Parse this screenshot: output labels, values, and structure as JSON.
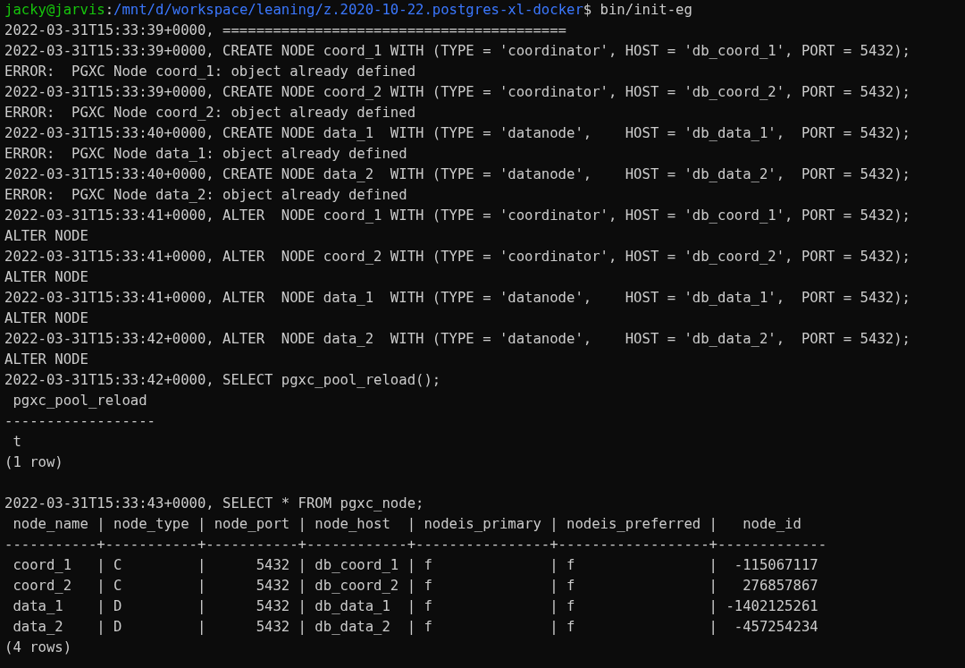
{
  "prompt": {
    "user_host": "jacky@jarvis",
    "separator": ":",
    "path": "/mnt/d/workspace/leaning/z.2020-10-22.postgres-xl-docker",
    "command": "$ bin/init-eg"
  },
  "blocks": [
    [
      "2022-03-31T15:33:39+0000, =========================================",
      "2022-03-31T15:33:39+0000, CREATE NODE coord_1 WITH (TYPE = 'coordinator', HOST = 'db_coord_1', PORT = 5432);",
      "ERROR:  PGXC Node coord_1: object already defined",
      "2022-03-31T15:33:39+0000, CREATE NODE coord_2 WITH (TYPE = 'coordinator', HOST = 'db_coord_2', PORT = 5432);",
      "ERROR:  PGXC Node coord_2: object already defined",
      "2022-03-31T15:33:40+0000, CREATE NODE data_1  WITH (TYPE = 'datanode',    HOST = 'db_data_1',  PORT = 5432);",
      "ERROR:  PGXC Node data_1: object already defined",
      "2022-03-31T15:33:40+0000, CREATE NODE data_2  WITH (TYPE = 'datanode',    HOST = 'db_data_2',  PORT = 5432);",
      "ERROR:  PGXC Node data_2: object already defined",
      "2022-03-31T15:33:41+0000, ALTER  NODE coord_1 WITH (TYPE = 'coordinator', HOST = 'db_coord_1', PORT = 5432);",
      "ALTER NODE",
      "2022-03-31T15:33:41+0000, ALTER  NODE coord_2 WITH (TYPE = 'coordinator', HOST = 'db_coord_2', PORT = 5432);",
      "ALTER NODE",
      "2022-03-31T15:33:41+0000, ALTER  NODE data_1  WITH (TYPE = 'datanode',    HOST = 'db_data_1',  PORT = 5432);",
      "ALTER NODE",
      "2022-03-31T15:33:42+0000, ALTER  NODE data_2  WITH (TYPE = 'datanode',    HOST = 'db_data_2',  PORT = 5432);",
      "ALTER NODE",
      "2022-03-31T15:33:42+0000, SELECT pgxc_pool_reload();",
      " pgxc_pool_reload",
      "------------------",
      " t",
      "(1 row)"
    ],
    [
      "2022-03-31T15:33:43+0000, SELECT * FROM pgxc_node;",
      " node_name | node_type | node_port | node_host  | nodeis_primary | nodeis_preferred |   node_id",
      "-----------+-----------+-----------+------------+----------------+------------------+-------------",
      " coord_1   | C         |      5432 | db_coord_1 | f              | f                |  -115067117",
      " coord_2   | C         |      5432 | db_coord_2 | f              | f                |   276857867",
      " data_1    | D         |      5432 | db_data_1  | f              | f                | -1402125261",
      " data_2    | D         |      5432 | db_data_2  | f              | f                |  -457254234",
      "(4 rows)"
    ]
  ]
}
